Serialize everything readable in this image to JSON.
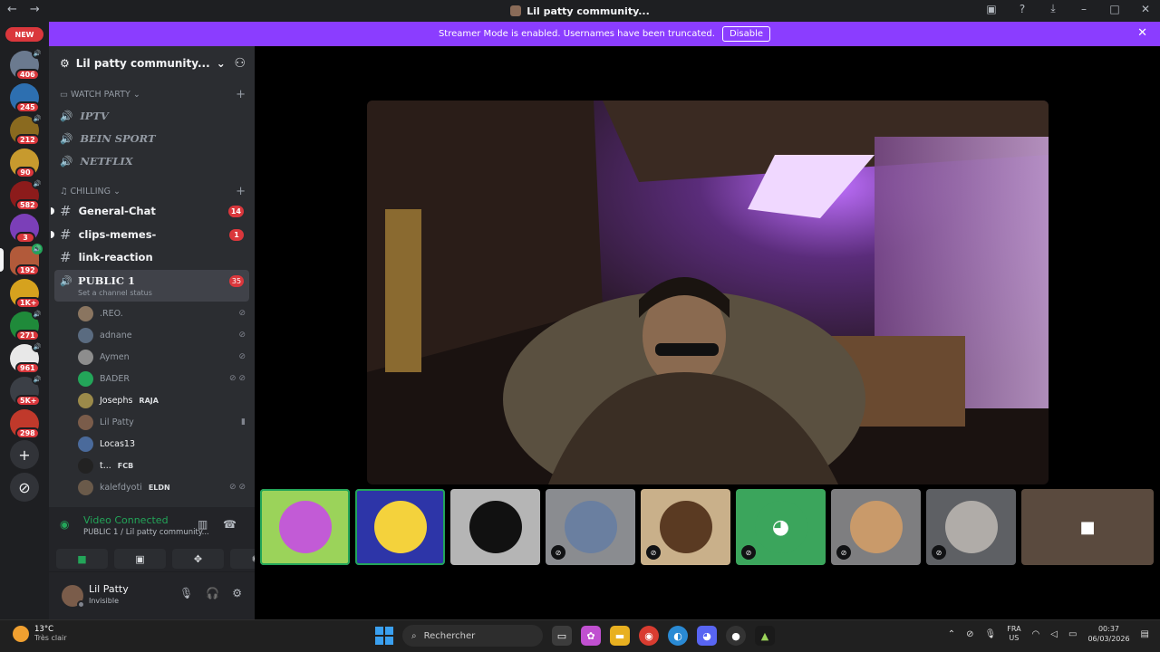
{
  "titlebar": {
    "title": "Lil patty community...",
    "back_icon": "←",
    "forward_icon": "→"
  },
  "banner": {
    "message": "Streamer Mode is enabled. Usernames have been truncated.",
    "button": "Disable"
  },
  "guilds": {
    "new_label": "NEW",
    "badges": [
      "406",
      "245",
      "212",
      "90",
      "582",
      "3",
      "192",
      "1K+",
      "271",
      "961",
      "5K+",
      "298"
    ]
  },
  "server": {
    "name": "Lil patty community..."
  },
  "categories": {
    "watch": "WATCH PARTY",
    "chill": "CHILLING"
  },
  "voice_channels": [
    "IPTV",
    "BEIN SPORT",
    "NETFLIX"
  ],
  "text_channels": [
    {
      "name": "General-Chat",
      "count": "14"
    },
    {
      "name": "clips-memes-",
      "count": "1"
    },
    {
      "name": "link-reaction",
      "count": ""
    }
  ],
  "public": {
    "name": "PUBLIC 1",
    "status": "Set a channel status",
    "count": "35"
  },
  "members": [
    {
      "name": ".REO.",
      "tag": ""
    },
    {
      "name": "adnane",
      "tag": ""
    },
    {
      "name": "Aymen",
      "tag": ""
    },
    {
      "name": "BADER",
      "tag": ""
    },
    {
      "name": "Josephs",
      "tag": "RAJA"
    },
    {
      "name": "Lil Patty",
      "tag": ""
    },
    {
      "name": "Locas13",
      "tag": ""
    },
    {
      "name": "t...",
      "tag": "FCB"
    },
    {
      "name": "kalefdyoti",
      "tag": "ELDN"
    }
  ],
  "voice_panel": {
    "state": "Video Connected",
    "channel": "PUBLIC 1 / Lil patty community..."
  },
  "user": {
    "name": "Lil Patty",
    "status": "Invisible"
  },
  "taskbar": {
    "temp": "13°C",
    "weather": "Très clair",
    "search": "Rechercher",
    "lang1": "FRA",
    "lang2": "US",
    "time": "00:37",
    "date": "06/03/2026"
  },
  "colors": {
    "accent": "#8b3dff",
    "green": "#23a559",
    "red": "#da373c",
    "discord": "#5865f2"
  }
}
